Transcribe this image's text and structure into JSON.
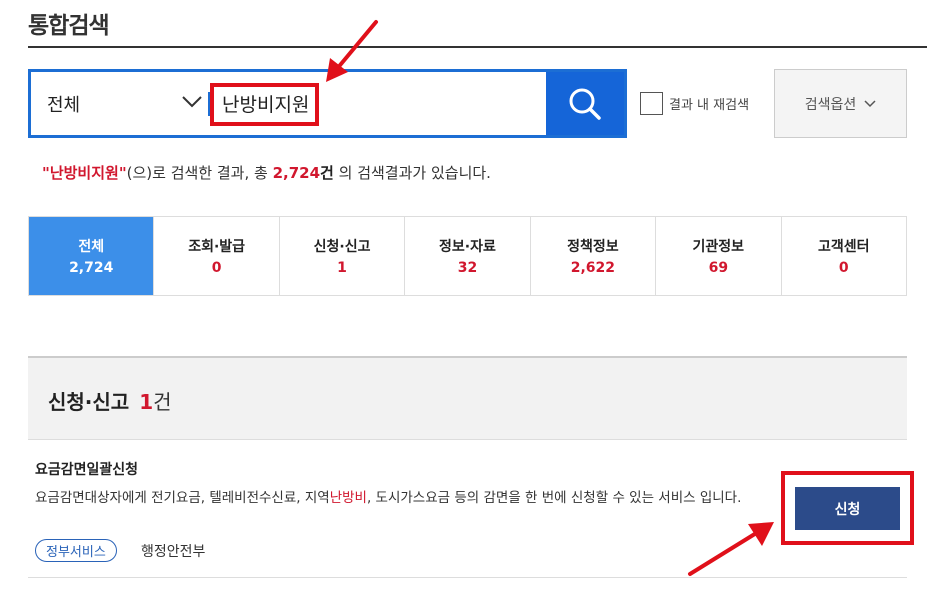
{
  "page": {
    "title": "통합검색"
  },
  "search": {
    "scope": "전체",
    "query": "난방비지원",
    "result_in_label": "결과 내 재검색",
    "options_label": "검색옵션"
  },
  "summary": {
    "keyword": "\"난방비지원\"",
    "text1": "(으)로 검색한 결과, 총 ",
    "count": "2,724",
    "unit": "건",
    "text2": " 의 검색결과가 있습니다."
  },
  "tabs": [
    {
      "label": "전체",
      "count": "2,724"
    },
    {
      "label": "조회·발급",
      "count": "0"
    },
    {
      "label": "신청·신고",
      "count": "1"
    },
    {
      "label": "정보·자료",
      "count": "32"
    },
    {
      "label": "정책정보",
      "count": "2,622"
    },
    {
      "label": "기관정보",
      "count": "69"
    },
    {
      "label": "고객센터",
      "count": "0"
    }
  ],
  "section": {
    "title": "신청·신고",
    "count": "1",
    "unit": "건"
  },
  "item": {
    "title": "요금감면일괄신청",
    "desc_part1": "요금감면대상자에게 전기요금, 텔레비전수신료, 지역",
    "desc_kw": "난방비",
    "desc_part2": ", 도시가스요금 등의 감면을 한 번에 신청할 수 있는 서비스 입니다.",
    "tag": "정부서비스",
    "ministry": "행정안전부",
    "apply_label": "신청"
  },
  "colors": {
    "accent_blue": "#1565d8",
    "highlight_red": "#e0101a",
    "apply_navy": "#2c4b8a"
  }
}
